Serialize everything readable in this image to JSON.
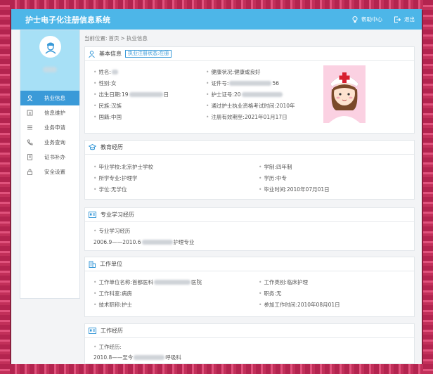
{
  "app": {
    "title": "护士电子化注册信息系统",
    "help_label": "帮助中心",
    "logout_label": "退出"
  },
  "sidebar": {
    "items": [
      {
        "label": "执业信息",
        "icon": "user-icon"
      },
      {
        "label": "信息维护",
        "icon": "edit-icon"
      },
      {
        "label": "业务申请",
        "icon": "list-icon"
      },
      {
        "label": "业务查询",
        "icon": "phone-icon"
      },
      {
        "label": "证书补办",
        "icon": "document-icon"
      },
      {
        "label": "安全设置",
        "icon": "lock-icon"
      }
    ]
  },
  "breadcrumb": {
    "prefix": "当前位置:",
    "home": "首页",
    "separator": ">",
    "current": "执业信息"
  },
  "basic": {
    "title": "基本信息",
    "status": "执业注册状态:在册",
    "name_label": "姓名:",
    "gender_label": "性别:",
    "gender_value": "女",
    "birth_label": "出生日期:",
    "birth_prefix": "19",
    "birth_suffix": "日",
    "ethnicity_label": "民族:",
    "ethnicity_value": "汉族",
    "nationality_label": "国籍:",
    "nationality_value": "中国",
    "health_label": "健康状况:",
    "health_value": "健康或良好",
    "id_label": "证件号:",
    "id_suffix": "56",
    "cert_label": "护士证号:",
    "cert_prefix": "20",
    "exam_label": "通过护士执业资格考试时间:",
    "exam_value": "2010年",
    "expiry_label": "注册有效期至:",
    "expiry_value": "2021年01月17日"
  },
  "education": {
    "title": "教育经历",
    "school_label": "毕业学校:",
    "school_value": "北京护士学校",
    "major_label": "所学专业:",
    "major_value": "护理学",
    "degree_label": "学位:",
    "degree_value": "无学位",
    "duration_label": "学制:",
    "duration_value": "四年制",
    "level_label": "学历:",
    "level_value": "中专",
    "grad_label": "毕业时间:",
    "grad_value": "2010年07月01日"
  },
  "study": {
    "title": "专业学习经历",
    "sub_label": "专业学习经历",
    "entry_prefix": "2006.9——2010.6",
    "entry_suffix": "护理专业"
  },
  "unit": {
    "title": "工作单位",
    "name_label": "工作单位名称:",
    "name_prefix": "首都医科",
    "name_suffix": "医院",
    "dept_label": "工作科室:",
    "dept_value": "病房",
    "tech_label": "技术职称:",
    "tech_value": "护士",
    "type_label": "工作类别:",
    "type_value": "临床护理",
    "duty_label": "职务:",
    "duty_value": "无",
    "start_label": "参加工作时间:",
    "start_value": "2010年08月01日"
  },
  "work": {
    "title": "工作经历",
    "sub_label": "工作经历:",
    "entry_prefix": "2010.8——至今",
    "entry_suffix": "呼吸科"
  },
  "colors": {
    "topbar": "#4db6e8",
    "active_nav": "#3a9ad8",
    "frame": "#b3244f"
  }
}
